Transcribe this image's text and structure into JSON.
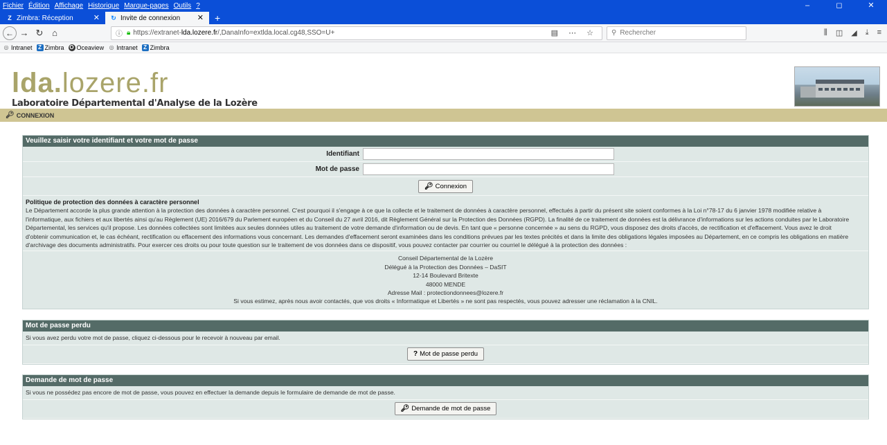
{
  "browser": {
    "menu": [
      "Fichier",
      "Édition",
      "Affichage",
      "Historique",
      "Marque-pages",
      "Outils",
      "?"
    ],
    "window_controls": [
      "–",
      "◻",
      "✕"
    ],
    "tabs": [
      {
        "label": "Zimbra: Réception",
        "icon": "Z"
      },
      {
        "label": "Invite de connexion",
        "icon": "↻"
      }
    ],
    "url_scheme": "https://extranet-",
    "url_domain": "lda.lozere.fr",
    "url_rest": "/,DanaInfo=extlda.local.cg48,SSO=U+",
    "search_placeholder": "Rechercher",
    "bookmarks": [
      "Intranet",
      "Zimbra",
      "Oceaview",
      "Intranet",
      "Zimbra"
    ]
  },
  "site": {
    "logo_bold": "lda.",
    "logo_light": "lozere.fr",
    "subtitle": "Laboratoire Départemental d'Analyse de la Lozère",
    "nav_label": "CONNEXION"
  },
  "login": {
    "heading": "Veuillez saisir votre identifiant et votre mot de passe",
    "id_label": "Identifiant",
    "id_value": "",
    "pw_label": "Mot de passe",
    "pw_value": "",
    "submit": "Connexion"
  },
  "policy": {
    "title": "Politique de protection des données à caractère personnel",
    "lines": [
      "Le Département accorde la plus grande attention à la protection des données à caractère personnel. C'est pourquoi il s'engage à ce que la collecte et le traitement de données à caractère personnel, effectués à partir du présent site soient conformes à la Loi n°78-17 du 6 janvier 1978 modifiée relative à",
      "l'informatique, aux fichiers et aux libertés ainsi qu'au Règlement (UE) 2016/679 du Parlement européen et du Conseil du 27 avril 2016, dit Règlement Général sur la Protection des Données (RGPD). La finalité de ce traitement de données est la délivrance d'informations sur les actions conduites par le Laboratoire",
      "Départemental, les services qu'il propose. Les données collectées sont limitées aux seules données utiles au traitement de votre demande d'information ou de devis. En tant que « personne concernée » au sens du RGPD, vous disposez des droits d'accès, de rectification et d'effacement. Vous avez le droit",
      "d'obtenir communication et, le cas échéant, rectification ou effacement des informations vous concernant. Les demandes d'effacement seront examinées dans les conditions prévues par les textes précités et dans la limite des obligations légales imposées au Département, en ce compris les obligations en matière",
      "d'archivage des documents administratifs. Pour exercer ces droits ou pour toute question sur le traitement de vos données dans ce dispositif, vous pouvez contacter par courrier ou courriel le délégué à la protection des données :"
    ],
    "contact": [
      "Conseil Départemental de la Lozère",
      "Délégué à la Protection des Données – DaSIT",
      "12-14 Boulevard Britexte",
      "48000 MENDE",
      "Adresse Mail : protectiondonnees@lozere.fr",
      "Si vous estimez, après nous avoir contactés, que vos droits « Informatique et Libertés » ne sont pas respectés, vous pouvez adresser une réclamation à la CNIL."
    ]
  },
  "lost": {
    "heading": "Mot de passe perdu",
    "text": "Si vous avez perdu votre mot de passe, cliquez ci-dessous pour le recevoir à nouveau par email.",
    "button": "Mot de passe perdu"
  },
  "request": {
    "heading": "Demande de mot de passe",
    "text": "Si vous ne possédez pas encore de mot de passe, vous pouvez en effectuer la demande depuis le formulaire de demande de mot de passe.",
    "button": "Demande de mot de passe"
  }
}
